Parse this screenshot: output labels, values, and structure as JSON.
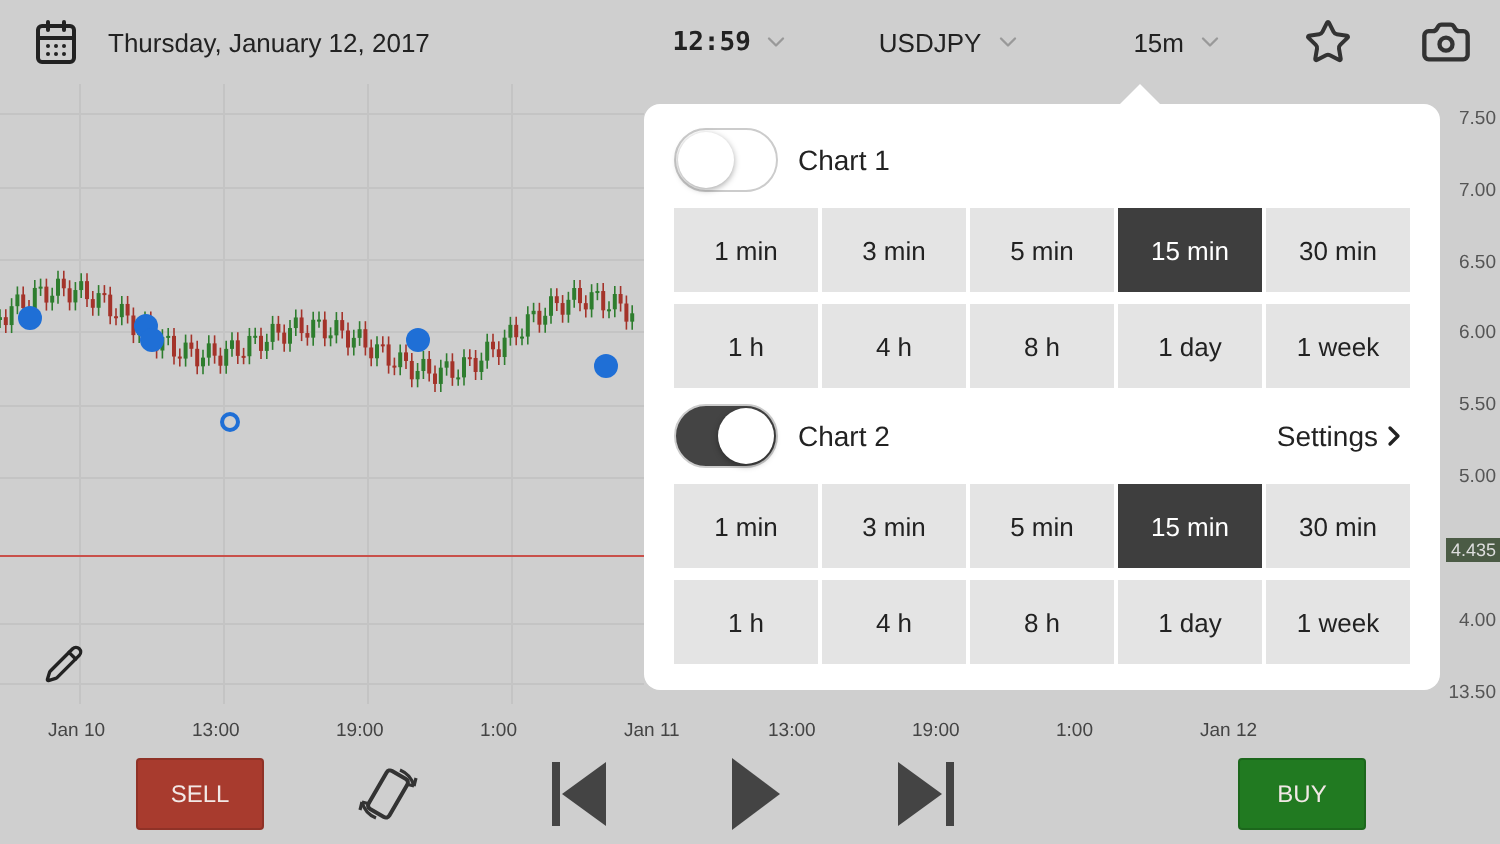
{
  "header": {
    "date": "Thursday, January 12, 2017",
    "time": "12:59",
    "symbol": "USDJPY",
    "interval": "15m"
  },
  "y_axis": [
    "7.50",
    "7.00",
    "6.50",
    "6.00",
    "5.50",
    "5.00",
    "4.00",
    "13.50"
  ],
  "price_tag": "4.435",
  "x_axis": [
    "Jan 10",
    "13:00",
    "19:00",
    "1:00",
    "Jan 11",
    "13:00",
    "19:00",
    "1:00",
    "Jan 12"
  ],
  "popover": {
    "charts": [
      {
        "label": "Chart 1",
        "on": false,
        "rows": [
          [
            {
              "label": "1 min",
              "selected": false
            },
            {
              "label": "3 min",
              "selected": false
            },
            {
              "label": "5 min",
              "selected": false
            },
            {
              "label": "15 min",
              "selected": true
            },
            {
              "label": "30 min",
              "selected": false
            }
          ],
          [
            {
              "label": "1 h",
              "selected": false
            },
            {
              "label": "4 h",
              "selected": false
            },
            {
              "label": "8 h",
              "selected": false
            },
            {
              "label": "1 day",
              "selected": false
            },
            {
              "label": "1 week",
              "selected": false
            }
          ]
        ]
      },
      {
        "label": "Chart 2",
        "on": true,
        "settings": "Settings",
        "rows": [
          [
            {
              "label": "1 min",
              "selected": false
            },
            {
              "label": "3 min",
              "selected": false
            },
            {
              "label": "5 min",
              "selected": false
            },
            {
              "label": "15 min",
              "selected": true
            },
            {
              "label": "30 min",
              "selected": false
            }
          ],
          [
            {
              "label": "1 h",
              "selected": false
            },
            {
              "label": "4 h",
              "selected": false
            },
            {
              "label": "8 h",
              "selected": false
            },
            {
              "label": "1 day",
              "selected": false
            },
            {
              "label": "1 week",
              "selected": false
            }
          ]
        ]
      }
    ]
  },
  "controls": {
    "sell": "SELL",
    "buy": "BUY"
  }
}
